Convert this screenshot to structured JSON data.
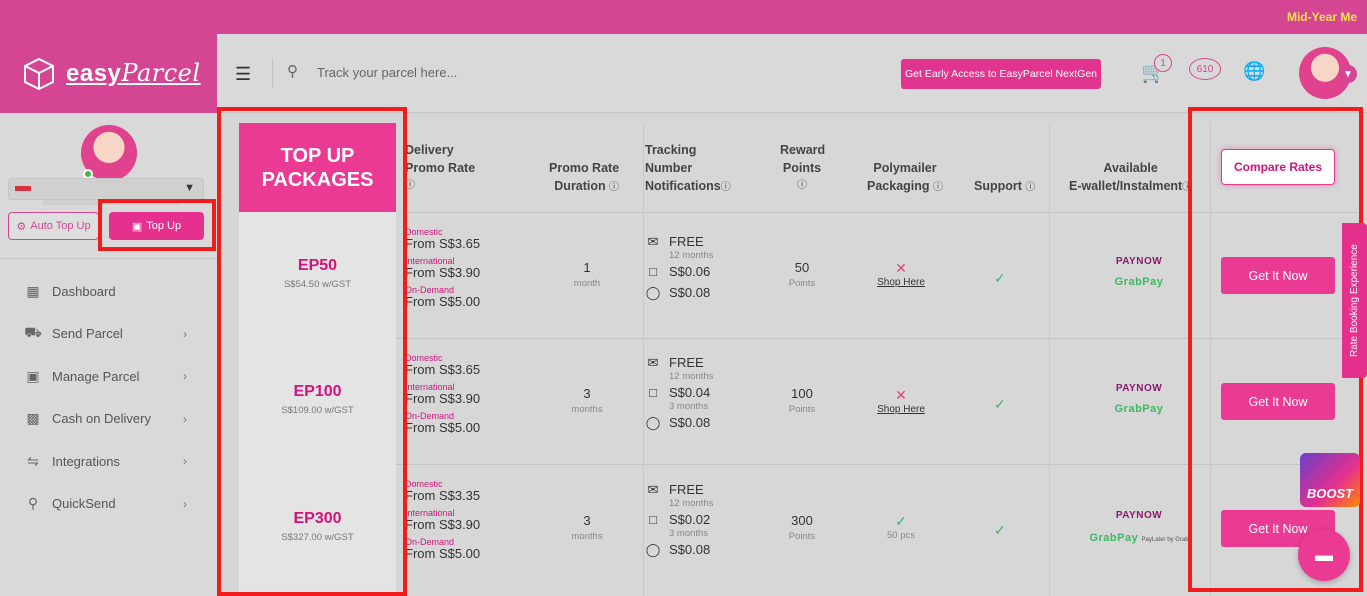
{
  "promo": {
    "text": "Mid-Year Me"
  },
  "sidebar": {
    "logo_prefix": "easy",
    "logo_suffix": "Parcel",
    "auto_topup": "Auto Top Up",
    "topup": "Top Up",
    "items": [
      {
        "label": "Dashboard",
        "icon": "dashboard-icon",
        "arrow": false
      },
      {
        "label": "Send Parcel",
        "icon": "truck-icon",
        "arrow": true
      },
      {
        "label": "Manage Parcel",
        "icon": "boxes-icon",
        "arrow": true
      },
      {
        "label": "Cash on Delivery",
        "icon": "cash-icon",
        "arrow": true
      },
      {
        "label": "Integrations",
        "icon": "link-icon",
        "arrow": true
      },
      {
        "label": "QuickSend",
        "icon": "cart-icon",
        "arrow": true
      }
    ]
  },
  "header": {
    "search_placeholder": "Track your parcel here...",
    "early_access": "Get Early Access to EasyParcel NextGen",
    "cart_count": "1",
    "notif_count": "610"
  },
  "table": {
    "title_line1": "TOP UP",
    "title_line2": "PACKAGES",
    "headers": {
      "delivery": [
        "Delivery",
        "Promo Rate"
      ],
      "duration": [
        "Promo Rate",
        "Duration"
      ],
      "tracking": [
        "Tracking",
        "Number",
        "Notifications"
      ],
      "reward": [
        "Reward",
        "Points"
      ],
      "polymailer": [
        "Polymailer",
        "Packaging"
      ],
      "support": "Support",
      "wallet": [
        "Available",
        "E-wallet/Instalment"
      ]
    },
    "compare": "Compare Rates",
    "rows": [
      {
        "name": "EP50",
        "price": "S$54.50 w/GST",
        "dom_label": "Domestic",
        "dom": "From S$3.65",
        "int_label": "International",
        "int": "From S$3.90",
        "ond_label": "On-Demand",
        "ond": "From S$5.00",
        "duration": "1",
        "duration_unit": "month",
        "email": "FREE",
        "email_sub": "12 months",
        "sms": "S$0.06",
        "sms_sub": "",
        "wa": "S$0.08",
        "points": "50",
        "points_unit": "Points",
        "poly": "Shop Here",
        "poly_x": true,
        "paynow": "PAYNOW",
        "grab": "GrabPay",
        "grab_extra": "",
        "cta": "Get It Now"
      },
      {
        "name": "EP100",
        "price": "S$109.00 w/GST",
        "dom_label": "Domestic",
        "dom": "From S$3.65",
        "int_label": "International",
        "int": "From S$3.90",
        "ond_label": "On-Demand",
        "ond": "From S$5.00",
        "duration": "3",
        "duration_unit": "months",
        "email": "FREE",
        "email_sub": "12 months",
        "sms": "S$0.04",
        "sms_sub": "3 months",
        "wa": "S$0.08",
        "points": "100",
        "points_unit": "Points",
        "poly": "Shop Here",
        "poly_x": true,
        "paynow": "PAYNOW",
        "grab": "GrabPay",
        "grab_extra": "",
        "cta": "Get It Now"
      },
      {
        "name": "EP300",
        "price": "S$327.00 w/GST",
        "dom_label": "Domestic",
        "dom": "From S$3.35",
        "int_label": "International",
        "int": "From S$3.90",
        "ond_label": "On-Demand",
        "ond": "From S$5.00",
        "duration": "3",
        "duration_unit": "months",
        "email": "FREE",
        "email_sub": "12 months",
        "sms": "S$0.02",
        "sms_sub": "3 months",
        "wa": "S$0.08",
        "points": "300",
        "points_unit": "Points",
        "poly": "50 pcs",
        "poly_x": false,
        "paynow": "PAYNOW",
        "grab": "GrabPay",
        "grab_extra": "PayLater by Grab",
        "cta": "Get It Now"
      }
    ]
  },
  "side_tab": "Rate Booking Experience",
  "boost": "BOOST",
  "colors": {
    "brand": "#d44694",
    "accent": "#ea3a93",
    "highlight": "#f31c1c"
  }
}
